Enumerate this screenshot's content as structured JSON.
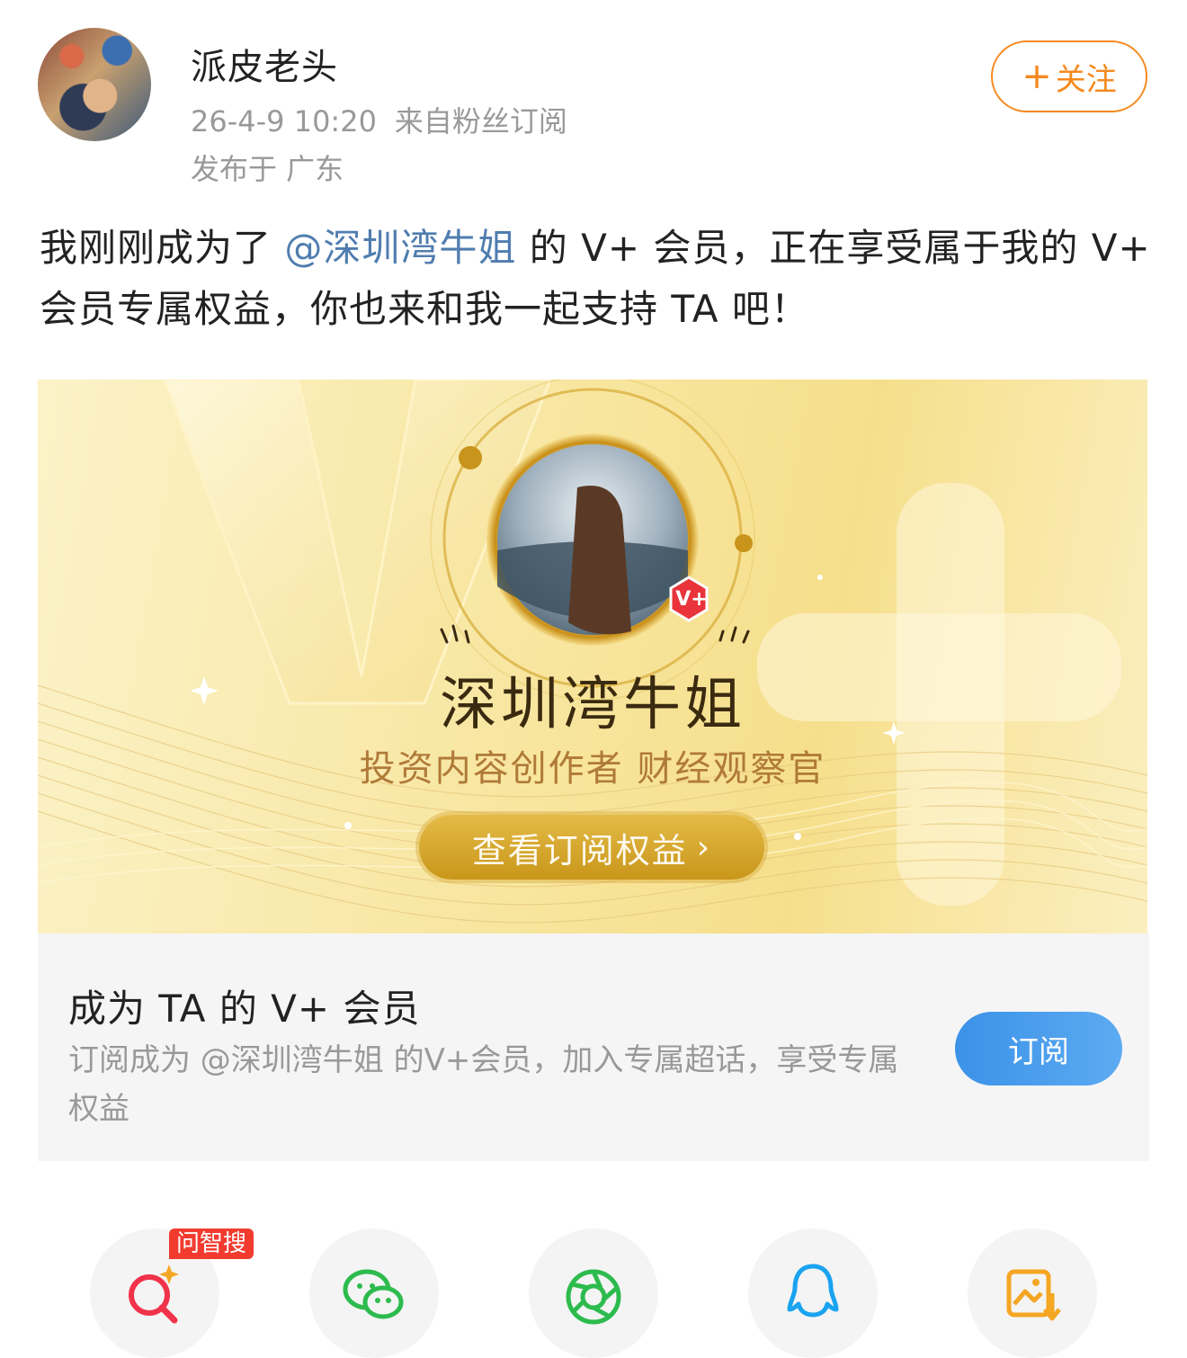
{
  "post": {
    "author": "派皮老头",
    "time": "26-4-9 10:20",
    "source": "来自粉丝订阅",
    "location": "发布于 广东",
    "follow_label": "关注",
    "text_before": "我刚刚成为了",
    "mention": "@深圳湾牛姐",
    "text_after": " 的 V+ 会员，正在享受属于我的 V+ 会员专属权益，你也来和我一起支持 TA 吧！"
  },
  "banner": {
    "creator_name": "深圳湾牛姐",
    "creator_title": "投资内容创作者 财经观察官",
    "benefits_button": "查看订阅权益",
    "vplus_badge": "V+"
  },
  "membership": {
    "title": "成为 TA 的 V+ 会员",
    "description": "订阅成为 @深圳湾牛姐 的V+会员，加入专属超话，享受专属权益",
    "subscribe_label": "订阅"
  },
  "share": {
    "badge": "问智搜",
    "icons": [
      "ai-search-icon",
      "wechat-icon",
      "moments-icon",
      "qq-icon",
      "save-image-icon"
    ]
  },
  "colors": {
    "accent_orange": "#f5891f",
    "mention_blue": "#507daf",
    "subscribe_blue": "#4a9ef0",
    "gold": "#d4a32a",
    "badge_red": "#f23b2f"
  }
}
